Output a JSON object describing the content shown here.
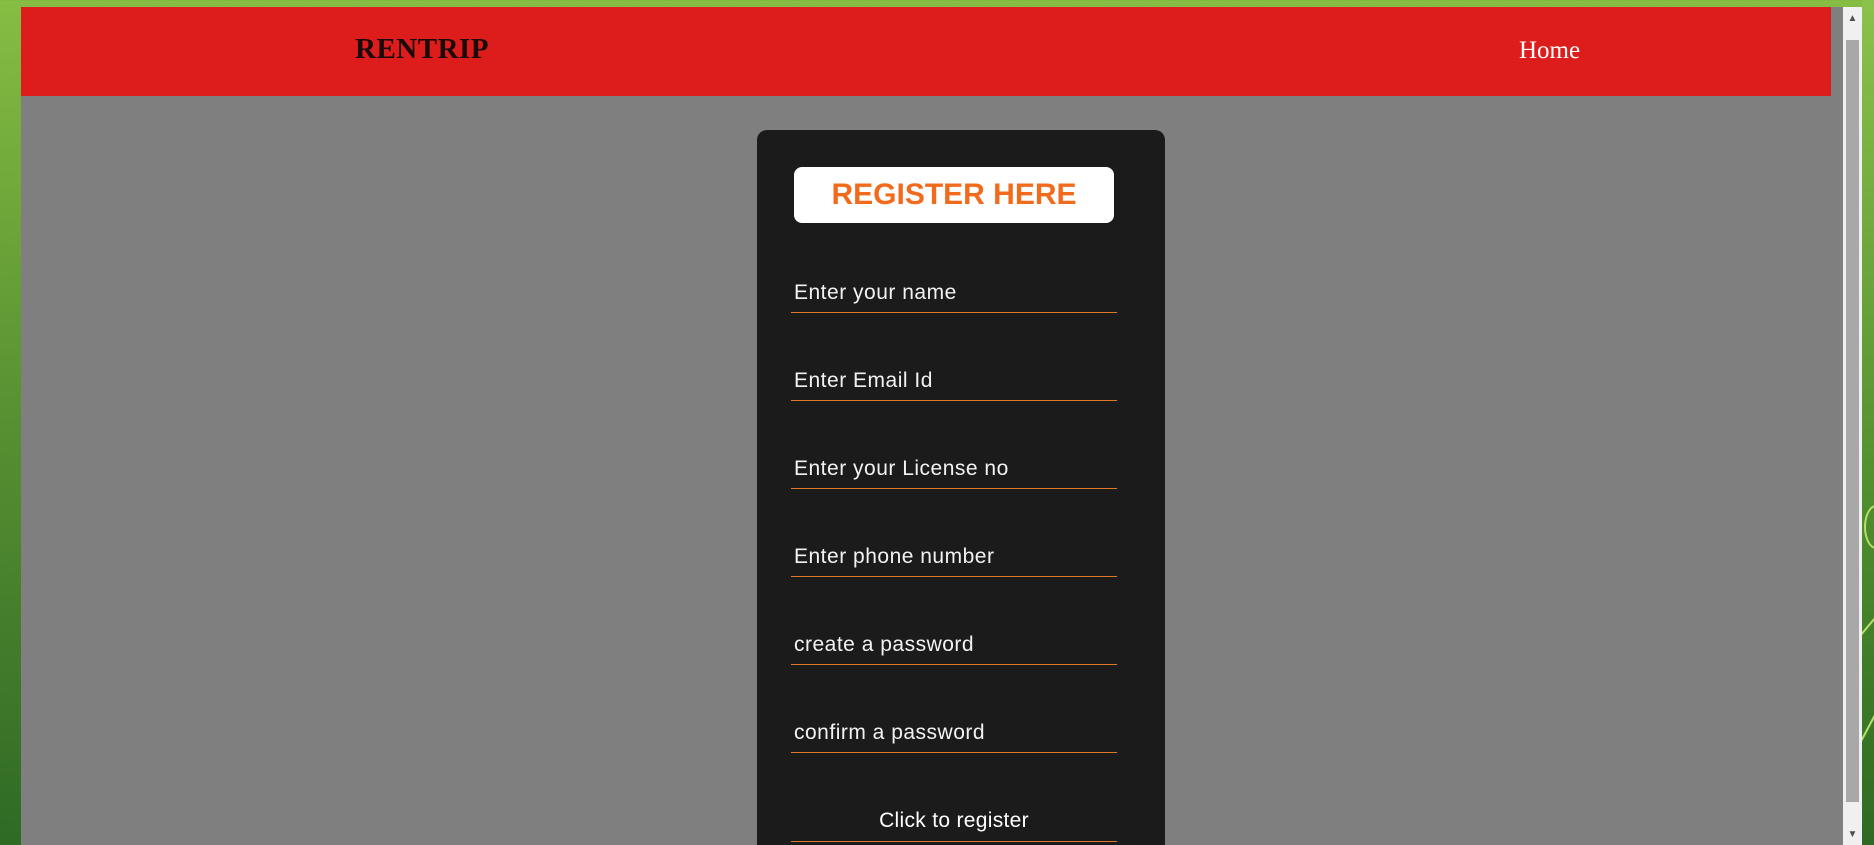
{
  "header": {
    "brand": "RENTRIP",
    "nav": {
      "home": "Home"
    }
  },
  "form": {
    "title": "REGISTER HERE",
    "fields": [
      {
        "placeholder": "Enter your name"
      },
      {
        "placeholder": "Enter Email Id"
      },
      {
        "placeholder": "Enter your License no"
      },
      {
        "placeholder": "Enter phone number"
      },
      {
        "placeholder": "create a password"
      },
      {
        "placeholder": "confirm a password"
      }
    ],
    "submit_label": "Click to register"
  },
  "colors": {
    "navbar": "#dd1c1c",
    "page_background": "#7f7f7f",
    "card_background": "#1b1b1b",
    "accent": "#f26b1d"
  },
  "icons": {
    "scroll_up": "scroll-up-arrow-icon",
    "scroll_down": "scroll-down-arrow-icon"
  }
}
